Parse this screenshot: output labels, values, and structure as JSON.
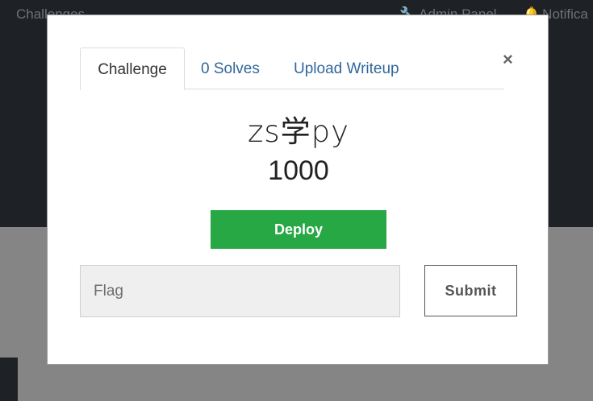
{
  "navbar": {
    "challenges_label": "Challenges",
    "admin_label": "Admin Panel",
    "notifications_label": "Notifica"
  },
  "modal": {
    "close_glyph": "×",
    "tabs": [
      {
        "label": "Challenge",
        "active": true
      },
      {
        "label": "0 Solves",
        "active": false
      },
      {
        "label": "Upload Writeup",
        "active": false
      }
    ],
    "challenge_name": "zs学py",
    "challenge_value": "1000",
    "deploy_label": "Deploy",
    "flag_placeholder": "Flag",
    "flag_value": "",
    "submit_label": "Submit"
  },
  "colors": {
    "deploy_green": "#28a745",
    "tab_link_blue": "#31679a",
    "overlay_dark": "#1e2226",
    "overlay_gray": "#858585"
  },
  "icons": {
    "admin": "wrench-icon",
    "notifications": "bell-icon",
    "close": "close-icon"
  }
}
